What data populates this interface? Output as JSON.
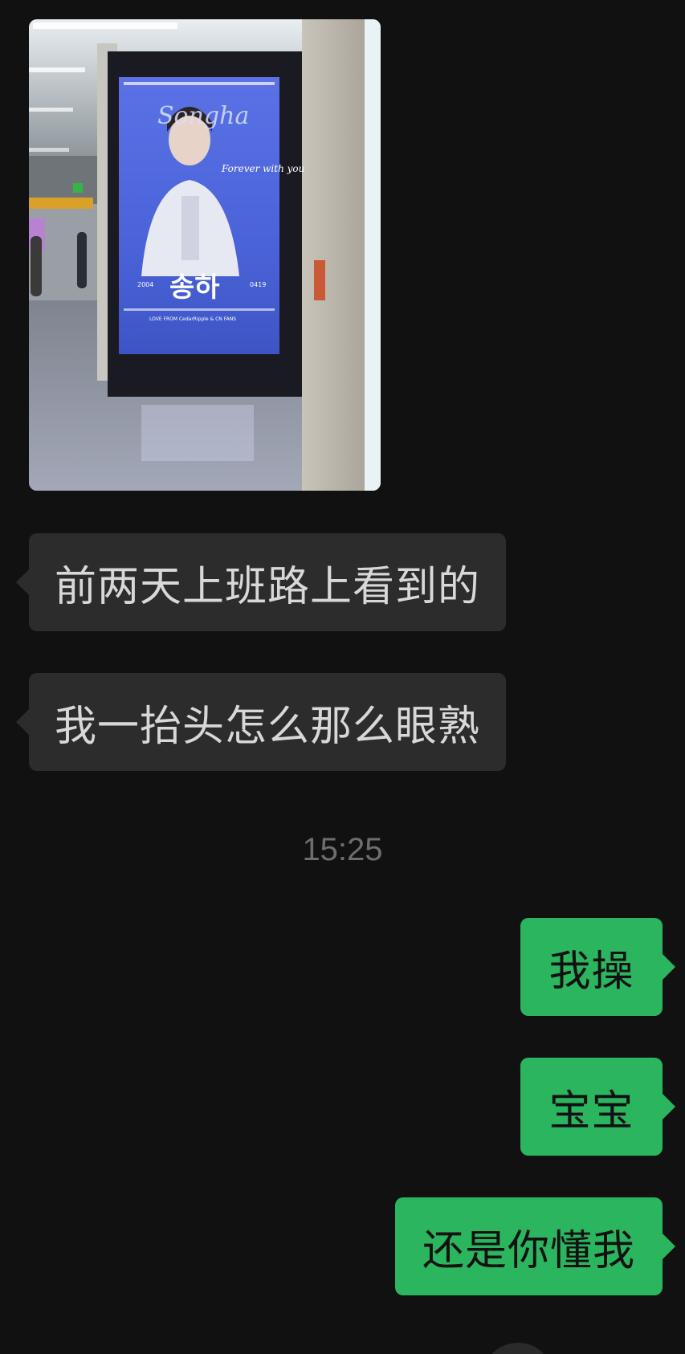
{
  "conversation": {
    "photo_message": {
      "poster_name_ko": "송하",
      "poster_title_en": "Songha",
      "poster_tagline": "Forever with you",
      "poster_footer": "LOVE FROM CedarRipple & CN FANS",
      "poster_year": "2004",
      "poster_date": "0419",
      "colors": {
        "poster_blue": "#4a63d8",
        "screen_frame": "#1a1a22"
      }
    },
    "incoming_messages": [
      {
        "text": "前两天上班路上看到的"
      },
      {
        "text": "我一抬头怎么那么眼熟"
      }
    ],
    "timestamp": "15:25",
    "outgoing_messages": [
      {
        "text": "我操"
      },
      {
        "text": "宝宝"
      },
      {
        "text": "还是你懂我"
      }
    ],
    "colors": {
      "background": "#111111",
      "incoming_bubble": "#2c2c2c",
      "outgoing_bubble": "#2bb55f"
    }
  }
}
